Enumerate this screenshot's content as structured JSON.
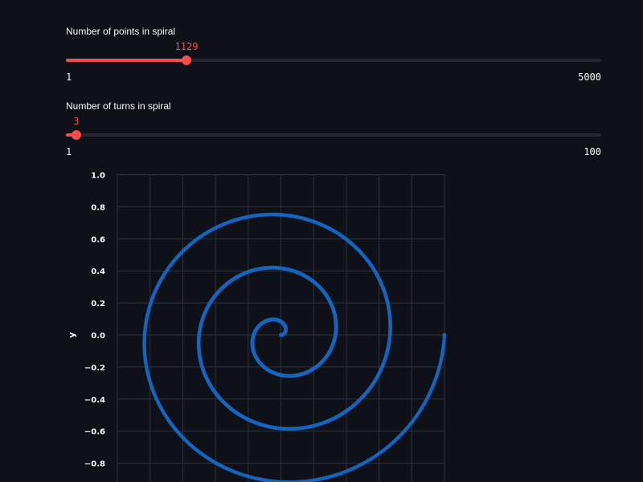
{
  "sliders": [
    {
      "label": "Number of points in spiral",
      "value": 1129,
      "value_text": "1129",
      "min": 1,
      "max": 5000,
      "min_text": "1",
      "max_text": "5000"
    },
    {
      "label": "Number of turns in spiral",
      "value": 3,
      "value_text": "3",
      "min": 1,
      "max": 100,
      "min_text": "1",
      "max_text": "100"
    }
  ],
  "colors": {
    "background": "#0e1117",
    "accent": "#ff4b4b",
    "track": "#262730",
    "grid": "#31333f",
    "points": "#1565c0",
    "text": "#fafafa"
  },
  "chart_data": {
    "type": "scatter",
    "title": "",
    "xlabel": "",
    "ylabel": "y",
    "spiral": {
      "num_points": 1129,
      "num_turns": 3
    },
    "yticks": [
      "1.0",
      "0.8",
      "0.6",
      "0.4",
      "0.2",
      "0.0",
      "−0.2",
      "−0.4",
      "−0.6",
      "−0.8"
    ],
    "ylim": [
      -1.0,
      1.0
    ],
    "xlim": [
      -1.0,
      1.0
    ],
    "grid": true
  }
}
